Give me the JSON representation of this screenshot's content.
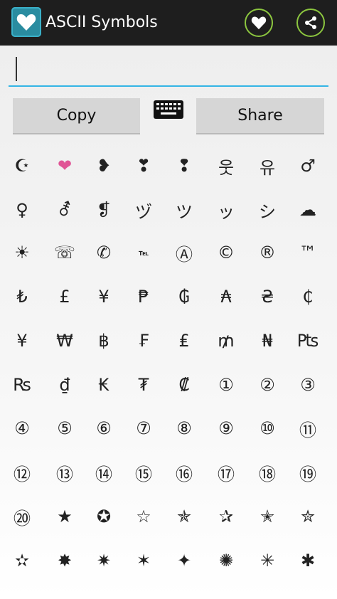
{
  "header": {
    "title": "ASCII Symbols"
  },
  "search": {
    "value": "",
    "placeholder": ""
  },
  "buttons": {
    "copy_label": "Copy",
    "share_label": "Share"
  },
  "symbol_rows": [
    [
      "☪",
      "❤",
      "❥",
      "❣",
      "❢",
      "웃",
      "유",
      "♂"
    ],
    [
      "♀",
      "⚦",
      "❡",
      "ヅ",
      "ツ",
      "ッ",
      "シ",
      "☁"
    ],
    [
      "☀",
      "☏",
      "✆",
      "℡",
      "Ⓐ",
      "©",
      "®",
      "™"
    ],
    [
      "₺",
      "£",
      "¥",
      "₱",
      "₲",
      "₳",
      "₴",
      "₵"
    ],
    [
      "¥",
      "₩",
      "฿",
      "₣",
      "₤",
      "₥",
      "₦",
      "₧"
    ],
    [
      "₨",
      "₫",
      "₭",
      "₮",
      "₡",
      "①",
      "②",
      "③"
    ],
    [
      "④",
      "⑤",
      "⑥",
      "⑦",
      "⑧",
      "⑨",
      "⑩",
      "⑪"
    ],
    [
      "⑫",
      "⑬",
      "⑭",
      "⑮",
      "⑯",
      "⑰",
      "⑱",
      "⑲"
    ],
    [
      "⑳",
      "★",
      "✪",
      "☆",
      "✯",
      "✰",
      "✭",
      "✮"
    ],
    [
      "✫",
      "✸",
      "✷",
      "✶",
      "✦",
      "✺",
      "✳",
      "✱"
    ]
  ],
  "colors": {
    "actionbar": "#1e1e1e",
    "accent_green": "#8cc63f",
    "input_underline": "#33b5e5",
    "heart_pink": "#e05596"
  },
  "icons": {
    "app": "heart-icon",
    "favorite": "heart-icon",
    "share": "share-icon",
    "keyboard": "keyboard-icon"
  }
}
